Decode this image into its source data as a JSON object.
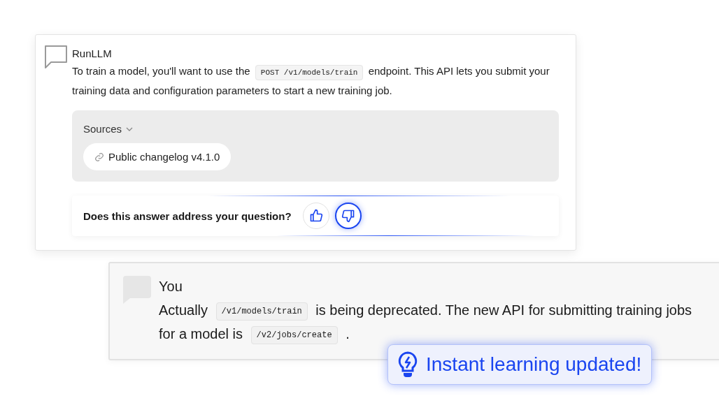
{
  "assistant_message": {
    "author": "RunLLM",
    "body": [
      {
        "kind": "text",
        "text": "To train a model, you'll want to use the "
      },
      {
        "kind": "code",
        "text": "POST /v1/models/train"
      },
      {
        "kind": "text",
        "text": " endpoint. This API lets you submit your training data and configuration parameters to start a new training job."
      }
    ],
    "sources": {
      "label": "Sources",
      "expanded": true,
      "items": [
        "Public changelog v4.1.0"
      ]
    },
    "feedback": {
      "question": "Does this answer address your question?",
      "buttons": [
        {
          "kind": "thumbs_up",
          "selected": false
        },
        {
          "kind": "thumbs_down",
          "selected": true
        }
      ]
    }
  },
  "user_message": {
    "author": "You",
    "body": [
      {
        "kind": "text",
        "text": "Actually "
      },
      {
        "kind": "code",
        "text": "/v1/models/train"
      },
      {
        "kind": "text",
        "text": " is being deprecated. The new API for submitting training jobs for a model is "
      },
      {
        "kind": "code",
        "text": "/v2/jobs/create"
      },
      {
        "kind": "text",
        "text": " ."
      }
    ]
  },
  "toast": {
    "text": "Instant learning updated!"
  }
}
